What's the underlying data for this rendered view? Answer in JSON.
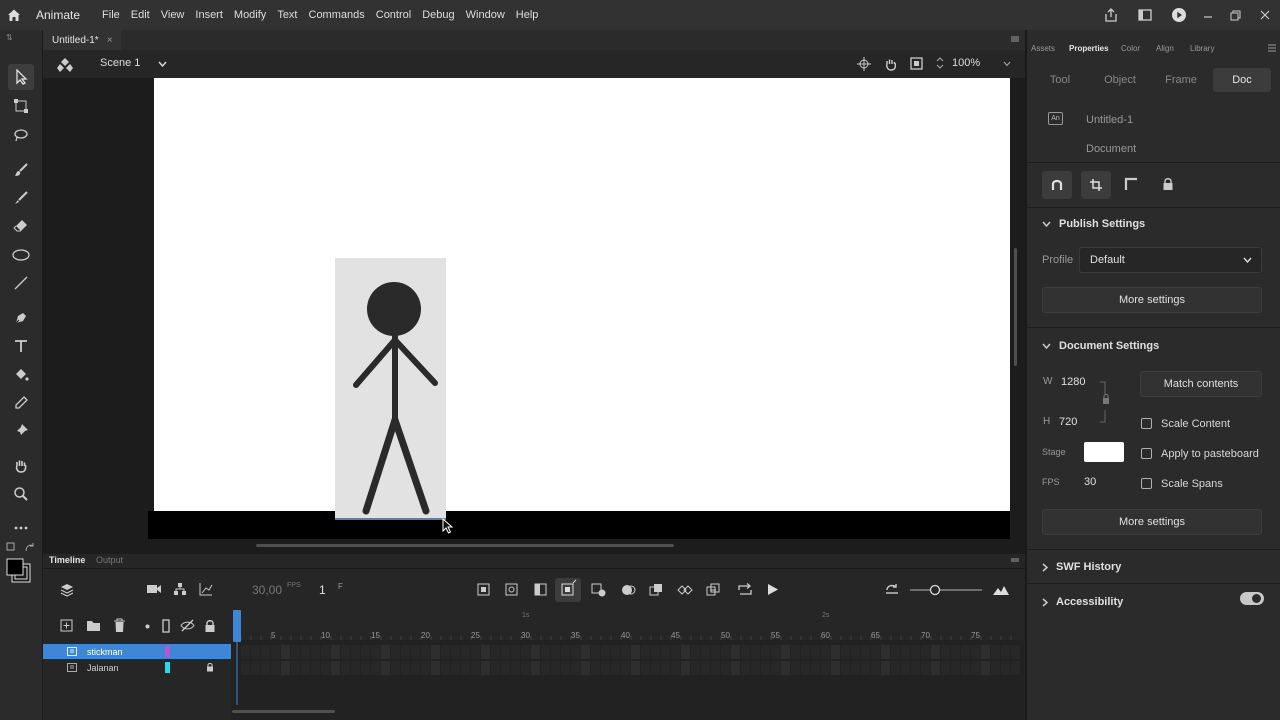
{
  "app": {
    "name": "Animate"
  },
  "menu": [
    "File",
    "Edit",
    "View",
    "Insert",
    "Modify",
    "Text",
    "Commands",
    "Control",
    "Debug",
    "Window",
    "Help"
  ],
  "document": {
    "tab_title": "Untitled-1*",
    "tab_close": "×"
  },
  "scene": {
    "label": "Scene 1"
  },
  "zoom": {
    "value": "100%"
  },
  "timeline": {
    "tabs": [
      "Timeline",
      "Output"
    ],
    "fps": "30,00",
    "fps_unit": "FPS",
    "current_frame": "1",
    "frame_unit": "F",
    "ruler": [
      "5",
      "10",
      "15",
      "20",
      "25",
      "30",
      "35",
      "40",
      "45",
      "50",
      "55",
      "60",
      "65",
      "70",
      "75"
    ],
    "ruler_seconds": [
      "1s",
      "2s"
    ],
    "layers": [
      {
        "name": "stickman",
        "color": "#b05ad8",
        "selected": true,
        "locked": false
      },
      {
        "name": "Jalanan",
        "color": "#2fd8e8",
        "selected": false,
        "locked": true
      }
    ]
  },
  "properties": {
    "panel_tabs": [
      "Assets",
      "Properties",
      "Color",
      "Align",
      "Library"
    ],
    "active_panel_tab": "Properties",
    "sub_tabs": [
      "Tool",
      "Object",
      "Frame",
      "Doc"
    ],
    "active_sub_tab": "Doc",
    "doc_name": "Untitled-1",
    "doc_type": "Document",
    "doc_icon": "An",
    "publish_settings": {
      "title": "Publish Settings",
      "profile_label": "Profile",
      "profile_value": "Default",
      "more_settings": "More settings"
    },
    "document_settings": {
      "title": "Document Settings",
      "w_label": "W",
      "w_value": "1280",
      "h_label": "H",
      "h_value": "720",
      "match_contents": "Match contents",
      "scale_content": "Scale Content",
      "stage_label": "Stage",
      "stage_color": "#ffffff",
      "apply_to_pasteboard": "Apply to pasteboard",
      "fps_label": "FPS",
      "fps_value": "30",
      "scale_spans": "Scale Spans",
      "more_settings": "More settings"
    },
    "swf_history": "SWF History",
    "accessibility": "Accessibility",
    "accessibility_on": true
  },
  "colors": {
    "accent": "#3f86d6",
    "stage": "#ffffff",
    "ground": "#000000",
    "stickman": "#2a2a2a"
  }
}
